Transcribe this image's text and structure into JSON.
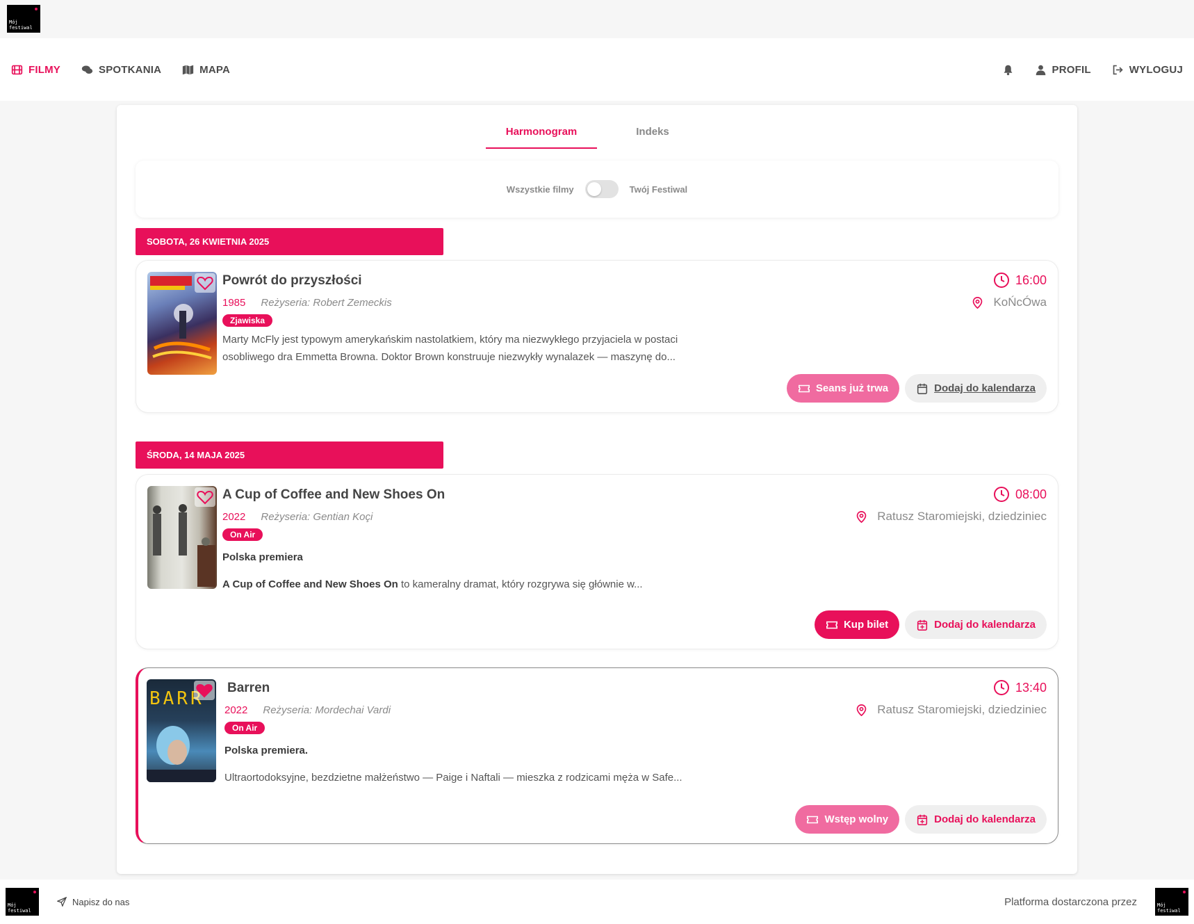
{
  "brand": {
    "logo_text": "Mój\nfestiwal"
  },
  "nav": {
    "left": [
      {
        "label": "FILMY",
        "icon": "film-icon",
        "active": true
      },
      {
        "label": "SPOTKANIA",
        "icon": "comments-icon",
        "active": false
      },
      {
        "label": "MAPA",
        "icon": "map-icon",
        "active": false
      }
    ],
    "right": [
      {
        "label": "",
        "icon": "bell-icon"
      },
      {
        "label": "PROFIL",
        "icon": "user-icon"
      },
      {
        "label": "WYLOGUJ",
        "icon": "logout-icon"
      }
    ]
  },
  "tabs": [
    {
      "label": "Harmonogram",
      "active": true
    },
    {
      "label": "Indeks",
      "active": false
    }
  ],
  "filter": {
    "left_label": "Wszystkie filmy",
    "right_label": "Twój Festiwal",
    "on": false
  },
  "days": [
    {
      "date": "SOBOTA, 26 KWIETNIA 2025"
    },
    {
      "date": "ŚRODA, 14 MAJA 2025"
    }
  ],
  "films": [
    {
      "title": "Powrót do przyszłości",
      "year": "1985",
      "director": "Reżyseria: Robert Zemeckis",
      "badge": "Zjawiska",
      "subtitle": "",
      "desc_bold": "",
      "description": "Marty McFly jest typowym amerykańskim nastolatkiem, który ma niezwykłego przyjaciela w postaci osobliwego dra Emmetta Browna. Doktor Brown konstruuje niezwykły wynalazek — maszynę do...",
      "time": "16:00",
      "place": "KoŃcÓwa",
      "favorite": false,
      "primary_button": "Seans już trwa",
      "calendar_button": "Dodaj do kalendarza"
    },
    {
      "title": "A Cup of Coffee and New Shoes On",
      "year": "2022",
      "director": "Reżyseria: Gentian Koçi",
      "badge": "On Air",
      "subtitle": "Polska premiera",
      "desc_bold": "A Cup of Coffee and New Shoes On",
      "description": " to kameralny dramat, który rozgrywa się głównie w...",
      "time": "08:00",
      "place": "Ratusz Staromiejski, dziedziniec",
      "favorite": false,
      "primary_button": "Kup bilet",
      "calendar_button": "Dodaj do kalendarza"
    },
    {
      "title": "Barren",
      "year": "2022",
      "director": "Reżyseria: Mordechai Vardi",
      "badge": "On Air",
      "subtitle": "Polska premiera.",
      "desc_bold": "",
      "description": "Ultraortodoksyjne, bezdzietne małżeństwo — Paige i Naftali — mieszka z rodzicami męża w Safe...",
      "time": "13:40",
      "place": "Ratusz Staromiejski, dziedziniec",
      "favorite": true,
      "primary_button": "Wstęp wolny",
      "calendar_button": "Dodaj do kalendarza"
    }
  ],
  "footer": {
    "contact": "Napisz do nas",
    "provided_by": "Platforma dostarczona przez"
  },
  "colors": {
    "accent": "#e8105a",
    "accent_light": "#f06ba0"
  }
}
